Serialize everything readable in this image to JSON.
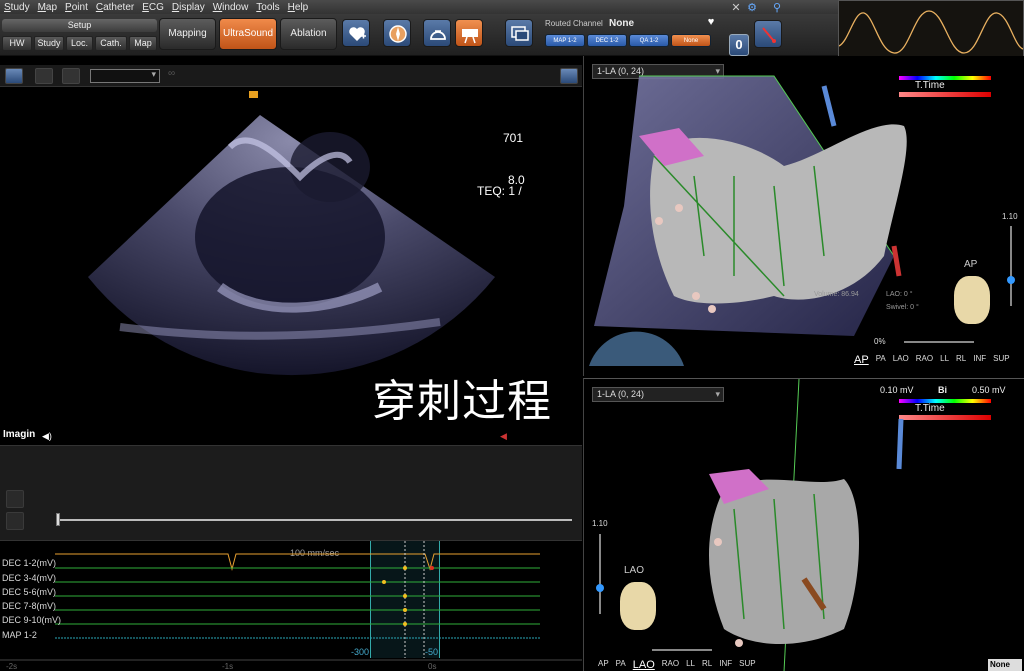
{
  "menu": [
    "Study",
    "Map",
    "Point",
    "Catheter",
    "ECG",
    "Display",
    "Window",
    "Tools",
    "Help"
  ],
  "setup": {
    "title": "Setup",
    "buttons": [
      "HW",
      "Study",
      "Loc.",
      "Cath.",
      "Map"
    ]
  },
  "modes": [
    {
      "label": "Mapping",
      "active": false
    },
    {
      "label": "UltraSound",
      "active": true
    },
    {
      "label": "Ablation",
      "active": false
    }
  ],
  "routed_channel": {
    "label": "Routed Channel",
    "value": "None",
    "channels": [
      "MAP 1-2",
      "DEC 1-2",
      "QA 1-2",
      "None"
    ]
  },
  "counter": "0",
  "ultrasound": {
    "readout_1": "701",
    "readout_2": "8.0",
    "readout_3": "TEQ: 1 /",
    "caption": "穿刺过程",
    "imaging_label": "Imagin"
  },
  "ecg": {
    "speed": "100 mm/sec",
    "channels": [
      "DEC 1-2(mV)",
      "DEC 3-4(mV)",
      "DEC 5-6(mV)",
      "DEC 7-8(mV)",
      "DEC 9-10(mV)",
      "MAP 1-2"
    ],
    "marker_left": "-300",
    "marker_right": "-50",
    "time_ticks": [
      "-2s",
      "-1s",
      "0s"
    ]
  },
  "map_top": {
    "dropdown": "1-LA (0, 24)",
    "legend_title": "T.Time",
    "scale": "1.10",
    "zoom": "0%",
    "orientation": "AP",
    "views": [
      "AP",
      "PA",
      "LAO",
      "RAO",
      "LL",
      "RL",
      "INF",
      "SUP"
    ],
    "selected_view": "AP",
    "stats": {
      "volume": "Volume: 86.94",
      "lao": "LAO:",
      "lao_val": "0 °",
      "swivel": "Swivel:",
      "swivel_val": "0 °"
    }
  },
  "map_bottom": {
    "dropdown": "1-LA (0, 24)",
    "bi_low": "0.10 mV",
    "bi_label": "Bi",
    "bi_high": "0.50 mV",
    "legend_title": "T.Time",
    "scale": "1.10",
    "orientation": "LAO",
    "views": [
      "AP",
      "PA",
      "LAO",
      "RAO",
      "LL",
      "RL",
      "INF",
      "SUP"
    ],
    "selected_view": "LAO",
    "selector_value": "None"
  }
}
